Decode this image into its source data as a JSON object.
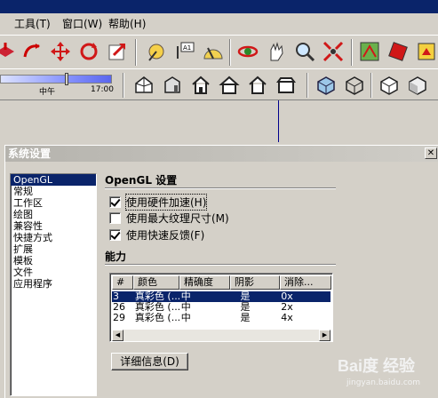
{
  "menu": [
    {
      "label": "工具(T)"
    },
    {
      "label": "窗口(W)"
    },
    {
      "label": "帮助(H)"
    }
  ],
  "sun_slider": {
    "left_label": "中午",
    "right_label": "17:00",
    "level": 0.58
  },
  "dialog": {
    "title": "系统设置",
    "close": "✕",
    "sidebar": [
      "OpenGL",
      "常规",
      "工作区",
      "绘图",
      "兼容性",
      "快捷方式",
      "扩展",
      "模板",
      "文件",
      "应用程序"
    ],
    "selected_index": 0,
    "opengl_section": "OpenGL 设置",
    "options": [
      {
        "label": "使用硬件加速(H)",
        "checked": true
      },
      {
        "label": "使用最大纹理尺寸(M)",
        "checked": false
      },
      {
        "label": "使用快速反馈(F)",
        "checked": true
      }
    ],
    "capability_section": "能力",
    "table": {
      "headers": [
        "#",
        "颜色",
        "精确度",
        "阴影",
        "消除..."
      ],
      "rows": [
        [
          "3",
          "真彩色 (...",
          "中",
          "是",
          "0x"
        ],
        [
          "26",
          "真彩色 (...",
          "中",
          "是",
          "2x"
        ],
        [
          "29",
          "真彩色 (...",
          "中",
          "是",
          "4x"
        ]
      ]
    },
    "details_button": "详细信息(D)"
  },
  "watermark": {
    "main": "Bai度 经验",
    "sub": "jingyan.baidu.com"
  }
}
